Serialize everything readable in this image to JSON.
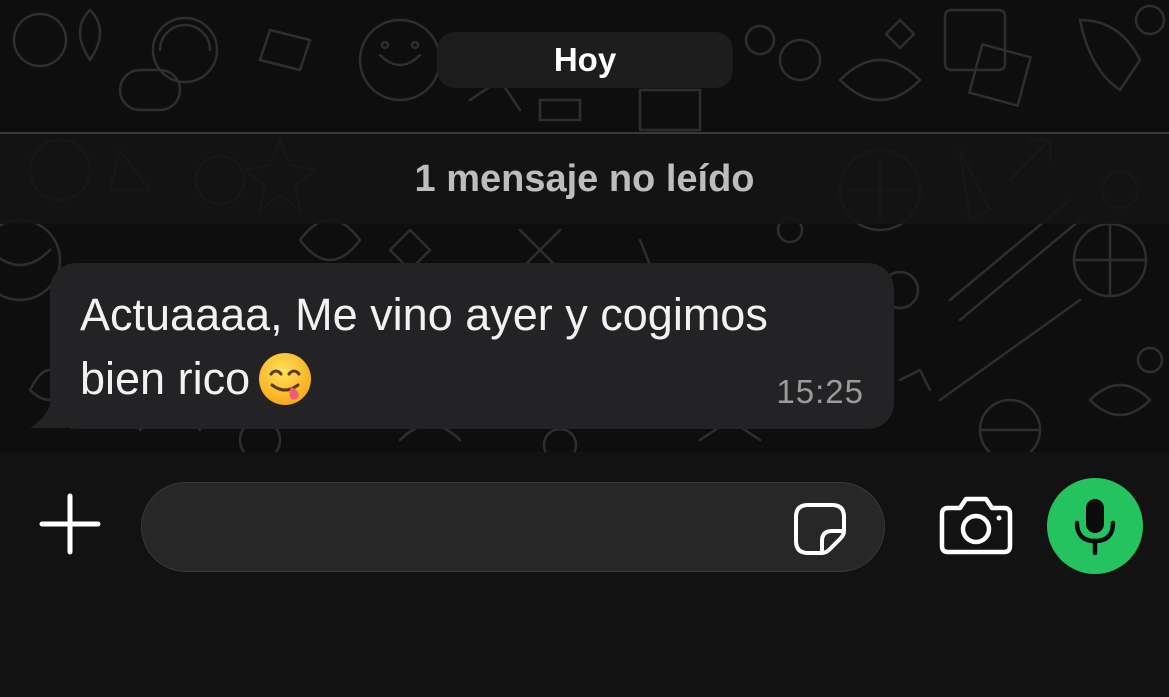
{
  "chat": {
    "date_label": "Hoy",
    "unread_label": "1 mensaje no leído",
    "message": {
      "text": "Actuaaaa, Me vino ayer y cogimos\nbien rico",
      "emoji": "face-savoring-food",
      "time": "15:25",
      "bubble_color": "#232325"
    }
  },
  "composer": {
    "input_value": "",
    "input_placeholder": "",
    "icons": [
      "plus-icon",
      "sticker-icon",
      "camera-icon",
      "microphone-icon"
    ],
    "mic_button_color": "#25c35f"
  }
}
